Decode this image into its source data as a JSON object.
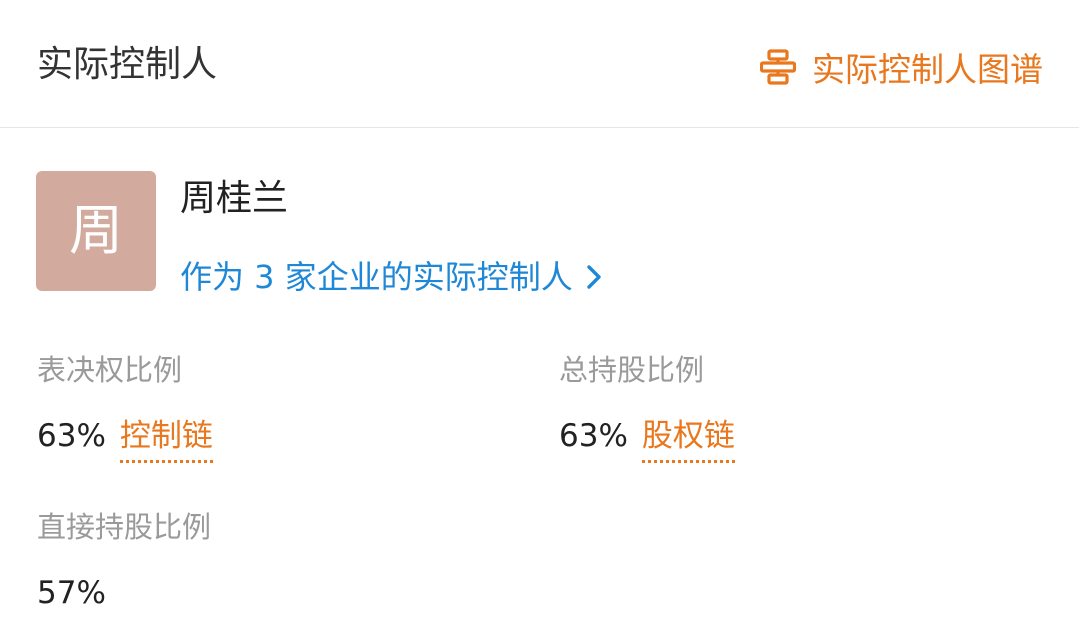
{
  "header": {
    "title": "实际控制人",
    "graph_link_label": "实际控制人图谱",
    "graph_icon": "org-chart-icon"
  },
  "person": {
    "avatar_char": "周",
    "name": "周桂兰",
    "controller_text": "作为 3 家企业的实际控制人"
  },
  "stats": {
    "voting": {
      "label": "表决权比例",
      "value": "63%",
      "link_label": "控制链"
    },
    "total_share": {
      "label": "总持股比例",
      "value": "63%",
      "link_label": "股权链"
    },
    "direct_share": {
      "label": "直接持股比例",
      "value": "57%"
    }
  },
  "colors": {
    "accent_orange": "#e8771d",
    "link_blue": "#1f88d6",
    "avatar_bg": "#d3ab9e",
    "label_gray": "#9a9a9a"
  }
}
